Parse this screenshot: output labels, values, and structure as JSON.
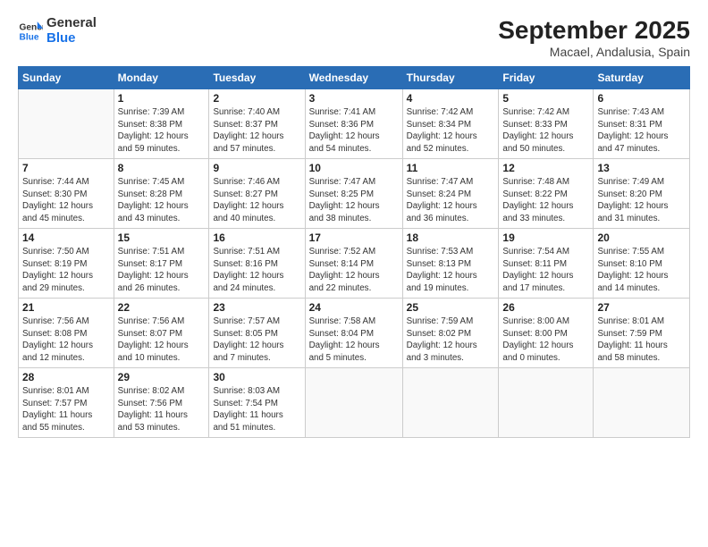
{
  "logo": {
    "line1": "General",
    "line2": "Blue"
  },
  "title": "September 2025",
  "location": "Macael, Andalusia, Spain",
  "days_header": [
    "Sunday",
    "Monday",
    "Tuesday",
    "Wednesday",
    "Thursday",
    "Friday",
    "Saturday"
  ],
  "weeks": [
    [
      {
        "day": "",
        "info": ""
      },
      {
        "day": "1",
        "info": "Sunrise: 7:39 AM\nSunset: 8:38 PM\nDaylight: 12 hours\nand 59 minutes."
      },
      {
        "day": "2",
        "info": "Sunrise: 7:40 AM\nSunset: 8:37 PM\nDaylight: 12 hours\nand 57 minutes."
      },
      {
        "day": "3",
        "info": "Sunrise: 7:41 AM\nSunset: 8:36 PM\nDaylight: 12 hours\nand 54 minutes."
      },
      {
        "day": "4",
        "info": "Sunrise: 7:42 AM\nSunset: 8:34 PM\nDaylight: 12 hours\nand 52 minutes."
      },
      {
        "day": "5",
        "info": "Sunrise: 7:42 AM\nSunset: 8:33 PM\nDaylight: 12 hours\nand 50 minutes."
      },
      {
        "day": "6",
        "info": "Sunrise: 7:43 AM\nSunset: 8:31 PM\nDaylight: 12 hours\nand 47 minutes."
      }
    ],
    [
      {
        "day": "7",
        "info": "Sunrise: 7:44 AM\nSunset: 8:30 PM\nDaylight: 12 hours\nand 45 minutes."
      },
      {
        "day": "8",
        "info": "Sunrise: 7:45 AM\nSunset: 8:28 PM\nDaylight: 12 hours\nand 43 minutes."
      },
      {
        "day": "9",
        "info": "Sunrise: 7:46 AM\nSunset: 8:27 PM\nDaylight: 12 hours\nand 40 minutes."
      },
      {
        "day": "10",
        "info": "Sunrise: 7:47 AM\nSunset: 8:25 PM\nDaylight: 12 hours\nand 38 minutes."
      },
      {
        "day": "11",
        "info": "Sunrise: 7:47 AM\nSunset: 8:24 PM\nDaylight: 12 hours\nand 36 minutes."
      },
      {
        "day": "12",
        "info": "Sunrise: 7:48 AM\nSunset: 8:22 PM\nDaylight: 12 hours\nand 33 minutes."
      },
      {
        "day": "13",
        "info": "Sunrise: 7:49 AM\nSunset: 8:20 PM\nDaylight: 12 hours\nand 31 minutes."
      }
    ],
    [
      {
        "day": "14",
        "info": "Sunrise: 7:50 AM\nSunset: 8:19 PM\nDaylight: 12 hours\nand 29 minutes."
      },
      {
        "day": "15",
        "info": "Sunrise: 7:51 AM\nSunset: 8:17 PM\nDaylight: 12 hours\nand 26 minutes."
      },
      {
        "day": "16",
        "info": "Sunrise: 7:51 AM\nSunset: 8:16 PM\nDaylight: 12 hours\nand 24 minutes."
      },
      {
        "day": "17",
        "info": "Sunrise: 7:52 AM\nSunset: 8:14 PM\nDaylight: 12 hours\nand 22 minutes."
      },
      {
        "day": "18",
        "info": "Sunrise: 7:53 AM\nSunset: 8:13 PM\nDaylight: 12 hours\nand 19 minutes."
      },
      {
        "day": "19",
        "info": "Sunrise: 7:54 AM\nSunset: 8:11 PM\nDaylight: 12 hours\nand 17 minutes."
      },
      {
        "day": "20",
        "info": "Sunrise: 7:55 AM\nSunset: 8:10 PM\nDaylight: 12 hours\nand 14 minutes."
      }
    ],
    [
      {
        "day": "21",
        "info": "Sunrise: 7:56 AM\nSunset: 8:08 PM\nDaylight: 12 hours\nand 12 minutes."
      },
      {
        "day": "22",
        "info": "Sunrise: 7:56 AM\nSunset: 8:07 PM\nDaylight: 12 hours\nand 10 minutes."
      },
      {
        "day": "23",
        "info": "Sunrise: 7:57 AM\nSunset: 8:05 PM\nDaylight: 12 hours\nand 7 minutes."
      },
      {
        "day": "24",
        "info": "Sunrise: 7:58 AM\nSunset: 8:04 PM\nDaylight: 12 hours\nand 5 minutes."
      },
      {
        "day": "25",
        "info": "Sunrise: 7:59 AM\nSunset: 8:02 PM\nDaylight: 12 hours\nand 3 minutes."
      },
      {
        "day": "26",
        "info": "Sunrise: 8:00 AM\nSunset: 8:00 PM\nDaylight: 12 hours\nand 0 minutes."
      },
      {
        "day": "27",
        "info": "Sunrise: 8:01 AM\nSunset: 7:59 PM\nDaylight: 11 hours\nand 58 minutes."
      }
    ],
    [
      {
        "day": "28",
        "info": "Sunrise: 8:01 AM\nSunset: 7:57 PM\nDaylight: 11 hours\nand 55 minutes."
      },
      {
        "day": "29",
        "info": "Sunrise: 8:02 AM\nSunset: 7:56 PM\nDaylight: 11 hours\nand 53 minutes."
      },
      {
        "day": "30",
        "info": "Sunrise: 8:03 AM\nSunset: 7:54 PM\nDaylight: 11 hours\nand 51 minutes."
      },
      {
        "day": "",
        "info": ""
      },
      {
        "day": "",
        "info": ""
      },
      {
        "day": "",
        "info": ""
      },
      {
        "day": "",
        "info": ""
      }
    ]
  ]
}
